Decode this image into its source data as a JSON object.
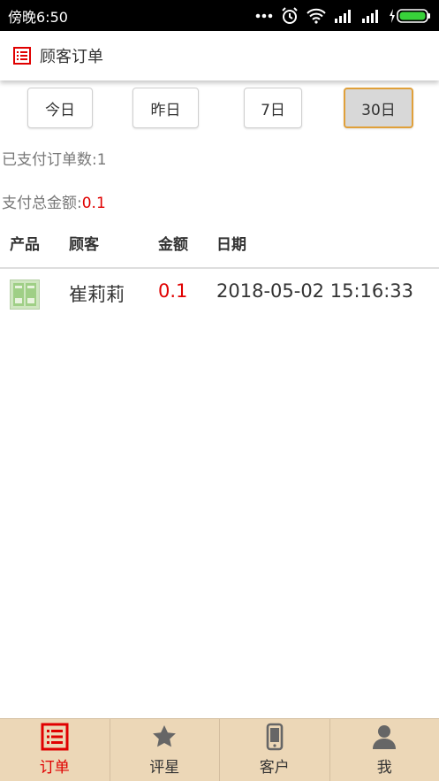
{
  "status_bar": {
    "time": "傍晚6:50"
  },
  "header": {
    "title": "顾客订单",
    "icon": "order-list-icon"
  },
  "filters": [
    {
      "label": "今日",
      "active": false
    },
    {
      "label": "昨日",
      "active": false
    },
    {
      "label": "7日",
      "active": false
    },
    {
      "label": "30日",
      "active": true
    }
  ],
  "stats": {
    "paid_orders_label": "已支付订单数:",
    "paid_orders_value": "1",
    "total_amount_label": "支付总金额:",
    "total_amount_value": "0.1"
  },
  "table": {
    "columns": [
      "产品",
      "顾客",
      "金额",
      "日期"
    ],
    "rows": [
      {
        "customer": "崔莉莉",
        "amount": "0.1",
        "date": "2018-05-02 15:16:33"
      }
    ]
  },
  "tabs": [
    {
      "label": "订单",
      "icon": "order-list-icon",
      "active": true
    },
    {
      "label": "评星",
      "icon": "star-icon",
      "active": false
    },
    {
      "label": "客户",
      "icon": "phone-icon",
      "active": false
    },
    {
      "label": "我",
      "icon": "person-icon",
      "active": false
    }
  ],
  "colors": {
    "accent": "#e00000",
    "tabbar_bg": "#ecd7b7",
    "active_border": "#e0a03a"
  }
}
